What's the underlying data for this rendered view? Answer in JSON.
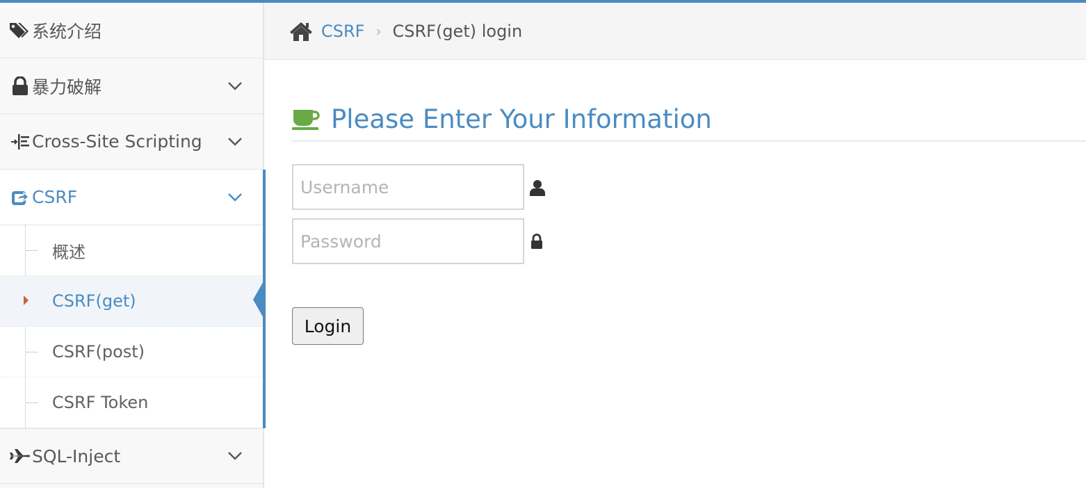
{
  "colors": {
    "accent": "#4a8bc2",
    "cup": "#69aa46",
    "caret": "#c86139"
  },
  "sidebar": {
    "items": [
      {
        "label": "系统介绍",
        "icon": "tags-icon"
      },
      {
        "label": "暴力破解",
        "icon": "lock-icon"
      },
      {
        "label": "Cross-Site Scripting",
        "icon": "indent-icon"
      },
      {
        "label": "CSRF",
        "icon": "share-square-icon"
      },
      {
        "label": "SQL-Inject",
        "icon": "plane-icon"
      }
    ],
    "csrf_submenu": [
      {
        "label": "概述"
      },
      {
        "label": "CSRF(get)"
      },
      {
        "label": "CSRF(post)"
      },
      {
        "label": "CSRF Token"
      }
    ]
  },
  "breadcrumb": {
    "home_icon": "home-icon",
    "link": "CSRF",
    "current": "CSRF(get) login"
  },
  "form": {
    "heading": "Please Enter Your Information",
    "username_placeholder": "Username",
    "password_placeholder": "Password",
    "submit_label": "Login"
  }
}
